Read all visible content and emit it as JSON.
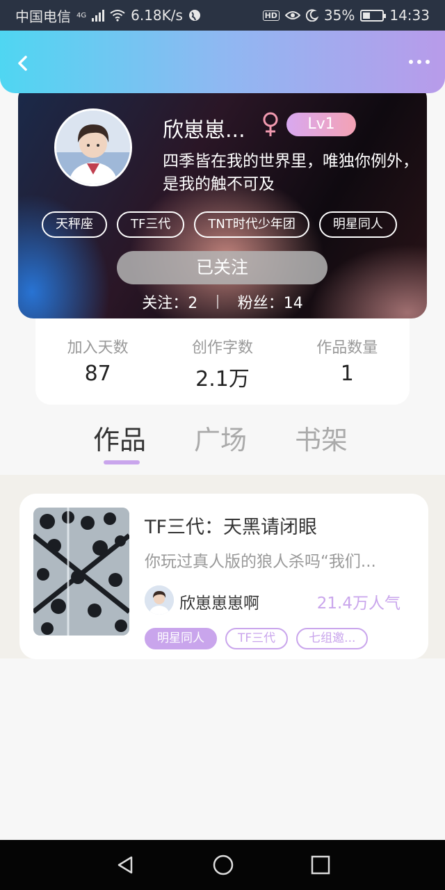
{
  "status_bar": {
    "carrier": "中国电信",
    "network": "4G",
    "speed": "6.18K/s",
    "battery": "35%",
    "time": "14:33"
  },
  "nav": {
    "back_icon": "chevron-left-icon",
    "more_icon": "more-dots-icon"
  },
  "profile": {
    "name": "欣崽崽...",
    "gender_icon": "female-icon",
    "level": "Lv1",
    "bio": "四季皆在我的世界里，唯独你例外，",
    "bio_line2": "是我的触不可及",
    "tags": [
      "天秤座",
      "TF三代",
      "TNT时代少年团",
      "明星同人"
    ],
    "follow_label": "已关注",
    "following_label": "关注：2",
    "fans_label": "粉丝：14"
  },
  "stats": [
    {
      "label": "加入天数",
      "value": "87"
    },
    {
      "label": "创作字数",
      "value": "2.1万"
    },
    {
      "label": "作品数量",
      "value": "1"
    }
  ],
  "tabs": [
    "作品",
    "广场",
    "书架"
  ],
  "active_tab": 0,
  "work": {
    "title": "TF三代：天黑请闭眼",
    "desc": "你玩过真人版的狼人杀吗“我们...",
    "author": "欣崽崽崽啊",
    "popularity": "21.4万人气",
    "tags": [
      "明星同人",
      "TF三代",
      "七组邀..."
    ]
  },
  "colors": {
    "accent": "#c9a5ec",
    "nav_gradient_start": "#4fd6f2",
    "nav_gradient_end": "#b89bea"
  }
}
